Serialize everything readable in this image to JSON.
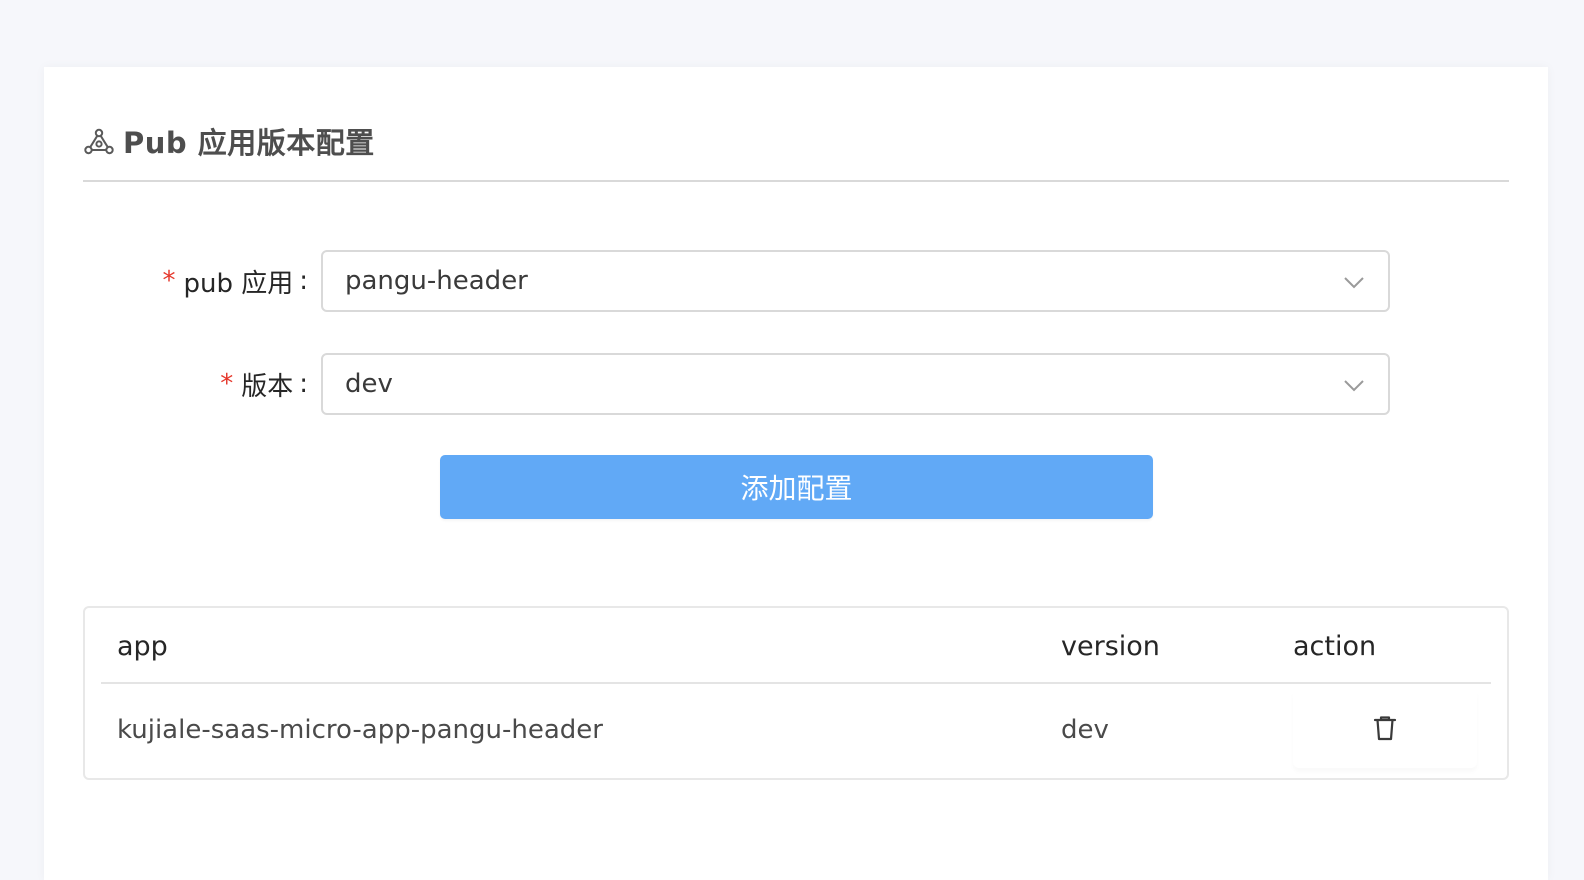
{
  "header": {
    "title": "Pub 应用版本配置",
    "icon": "deployment-unit-icon"
  },
  "form": {
    "app_field": {
      "label": "pub 应用",
      "required_mark": "*",
      "colon": ":",
      "value": "pangu-header"
    },
    "version_field": {
      "label": "版本",
      "required_mark": "*",
      "colon": ":",
      "value": "dev"
    },
    "submit_label": "添加配置"
  },
  "table": {
    "columns": [
      "app",
      "version",
      "action"
    ],
    "rows": [
      {
        "app": "kujiale-saas-micro-app-pangu-header",
        "version": "dev",
        "action_icon": "trash-icon"
      }
    ]
  },
  "colors": {
    "page_bg": "#f6f7fb",
    "primary": "#61a9f6",
    "required": "#e5372b",
    "border": "#d9d9d9"
  }
}
